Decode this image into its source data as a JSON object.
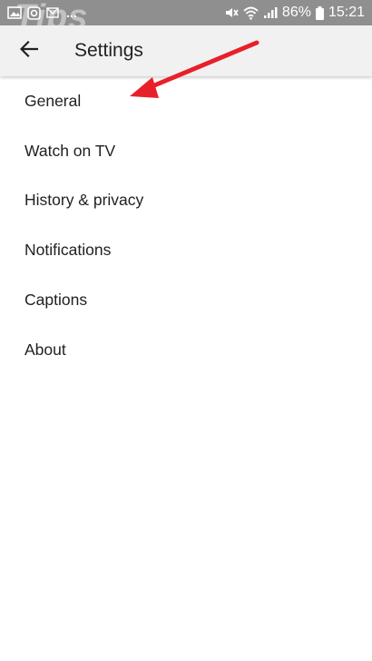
{
  "status_bar": {
    "battery": "86%",
    "time": "15:21",
    "more": "...",
    "watermark": "Tips"
  },
  "header": {
    "title": "Settings"
  },
  "settings": {
    "items": [
      {
        "label": "General"
      },
      {
        "label": "Watch on TV"
      },
      {
        "label": "History & privacy"
      },
      {
        "label": "Notifications"
      },
      {
        "label": "Captions"
      },
      {
        "label": "About"
      }
    ]
  },
  "colors": {
    "status_bar": "#8f8f8f",
    "app_bar": "#f1f1f1",
    "annotation_arrow": "#e8202a"
  }
}
